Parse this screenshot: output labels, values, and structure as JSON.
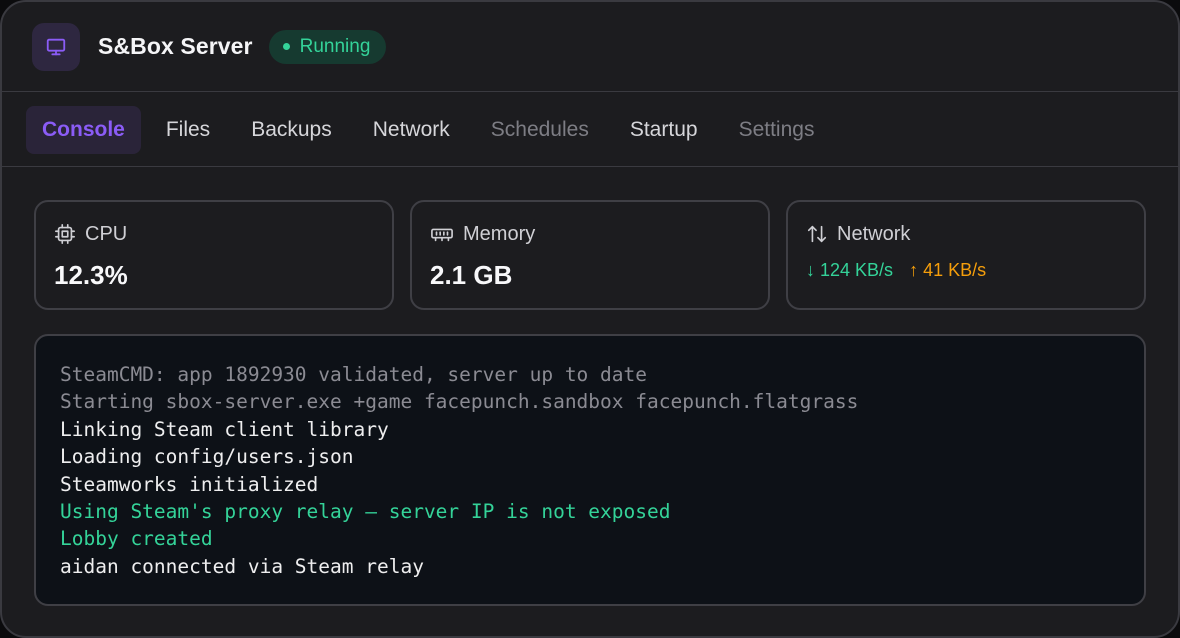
{
  "header": {
    "title": "S&Box Server",
    "icon": "monitor-icon",
    "status": "Running",
    "status_color": "#34d399",
    "accent_color": "#8b5cf6"
  },
  "tabs": [
    {
      "label": "Console",
      "state": "active"
    },
    {
      "label": "Files",
      "state": "normal"
    },
    {
      "label": "Backups",
      "state": "normal"
    },
    {
      "label": "Network",
      "state": "normal"
    },
    {
      "label": "Schedules",
      "state": "disabled"
    },
    {
      "label": "Startup",
      "state": "normal"
    },
    {
      "label": "Settings",
      "state": "disabled"
    }
  ],
  "stats": {
    "cpu": {
      "label": "CPU",
      "value": "12.3%",
      "icon": "cpu-chip-icon"
    },
    "memory": {
      "label": "Memory",
      "value": "2.1 GB",
      "icon": "memory-icon"
    },
    "network": {
      "label": "Network",
      "icon": "arrows-up-down-icon",
      "down": "124 KB/s",
      "up": "41 KB/s",
      "down_color": "#34d399",
      "up_color": "#f59e0b"
    }
  },
  "console": {
    "lines": [
      {
        "text": "SteamCMD: app 1892930 validated, server up to date",
        "kind": "dim"
      },
      {
        "text": "Starting sbox-server.exe +game facepunch.sandbox facepunch.flatgrass",
        "kind": "dim"
      },
      {
        "text": "Linking Steam client library",
        "kind": "normal"
      },
      {
        "text": "Loading config/users.json",
        "kind": "normal"
      },
      {
        "text": "Steamworks initialized",
        "kind": "normal"
      },
      {
        "text": "Using Steam's proxy relay — server IP is not exposed",
        "kind": "success"
      },
      {
        "text": "Lobby created",
        "kind": "success"
      },
      {
        "text": "aidan connected via Steam relay",
        "kind": "normal"
      }
    ]
  }
}
